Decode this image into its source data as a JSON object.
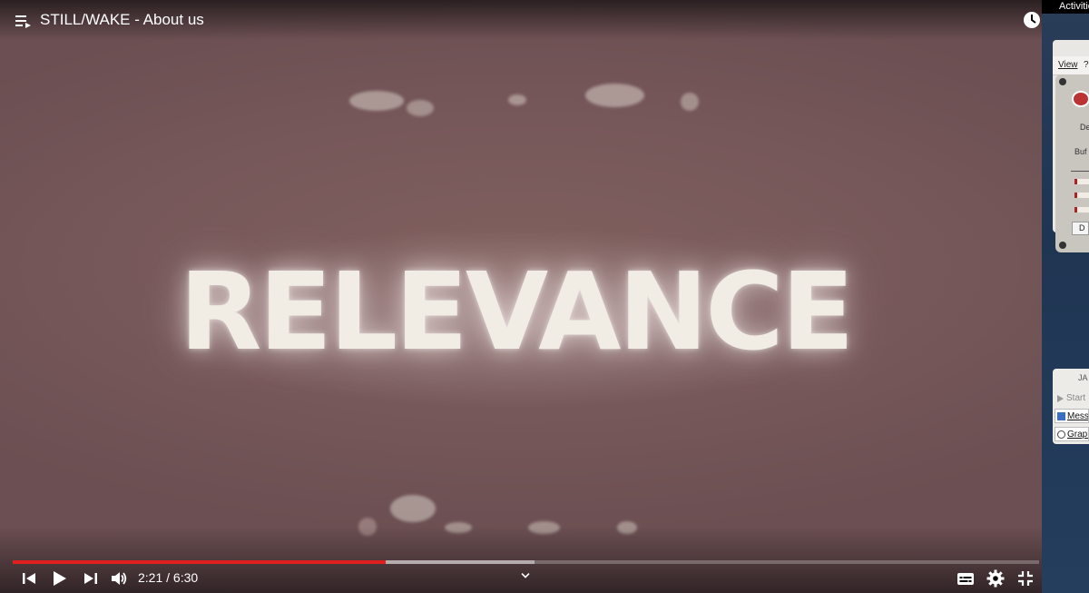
{
  "video": {
    "title": "STILL/WAKE - About us",
    "frame_text": "RELEVANCE",
    "progress_fraction": 0.363,
    "buffered_fraction": 0.508,
    "accent_color": "#e01f1f"
  },
  "player_controls": {
    "current_time": "2:21",
    "separator": " / ",
    "duration": "6:30",
    "icons": [
      "previous-icon",
      "play-icon",
      "next-icon",
      "volume-icon",
      "chevron-down-icon",
      "subtitles-icon",
      "gear-icon",
      "exit-fullscreen-icon"
    ]
  },
  "desktop": {
    "activities": "Activities",
    "window1": {
      "menu_view": "View",
      "menu_help": "?",
      "label_de": "De",
      "label_buf": "Buf",
      "button_partial": "D"
    },
    "window2": {
      "title_partial": "JA",
      "start": "Start",
      "messages": "Messa",
      "graph": "Graph"
    }
  }
}
